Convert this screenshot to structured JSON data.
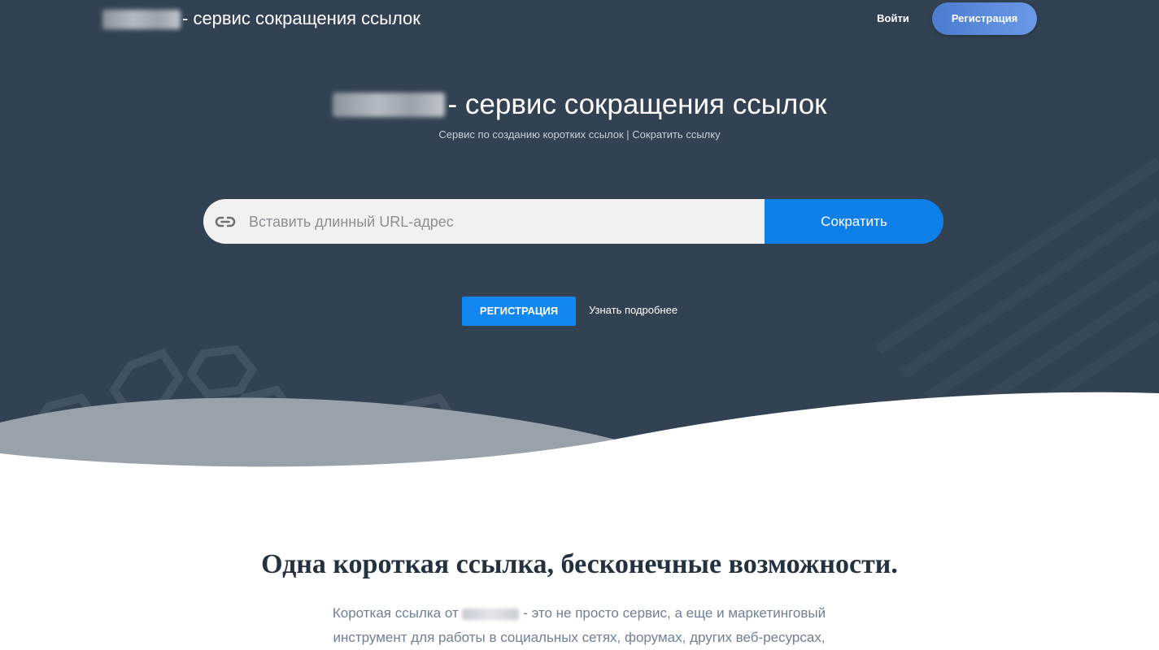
{
  "header": {
    "title_suffix": "- сервис сокращения ссылок",
    "login_label": "Войти",
    "register_label": "Регистрация"
  },
  "hero": {
    "title_suffix": "- сервис сокращения ссылок",
    "subtitle": "Сервис по созданию коротких ссылок | Сократить ссылку",
    "url_placeholder": "Вставить длинный URL-адрес",
    "shorten_label": "Сократить",
    "register_cta_label": "РЕГИСТРАЦИЯ",
    "learn_more_label": "Узнать подробнее"
  },
  "section": {
    "title": "Одна короткая ссылка, бесконечные возможности.",
    "text_part1": "Короткая ссылка от",
    "text_part2": "- это не просто сервис, а еще и маркетинговый",
    "text_line2": "инструмент для работы в социальных сетях, форумах, других веб-ресурсах,"
  },
  "colors": {
    "hero_bg": "#324252",
    "accent_blue": "#0f7fe8",
    "register_gradient_start": "#4c7ccf",
    "register_gradient_end": "#6a99e6"
  },
  "icons": {
    "link": "link-icon"
  }
}
